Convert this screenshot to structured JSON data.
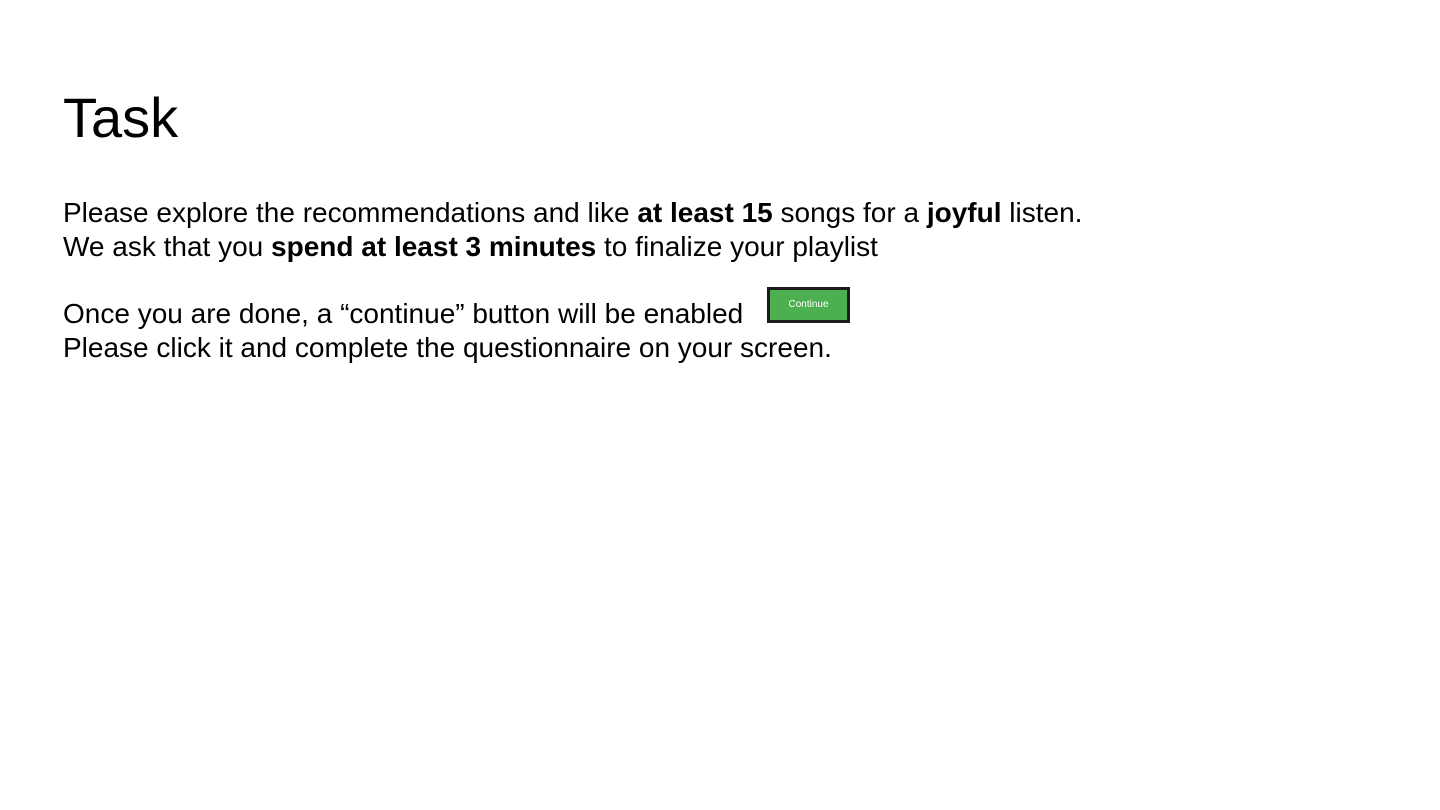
{
  "slide": {
    "title": "Task",
    "line1": {
      "a": "Please explore the recommendations and like ",
      "b": "at least 15",
      "c": " songs for a ",
      "d": "joyful",
      "e": " listen."
    },
    "line2": {
      "a": "We ask that you ",
      "b": "spend at least 3 minutes",
      "c": " to finalize your playlist"
    },
    "line3": "Once you are done, a “continue” button will be enabled",
    "line4": "Please click it and complete the questionnaire on your screen.",
    "continue_button_label": "Continue"
  },
  "colors": {
    "button_fill": "#4caf50",
    "button_border": "#1c1c1c",
    "text": "#000000",
    "background": "#ffffff"
  }
}
